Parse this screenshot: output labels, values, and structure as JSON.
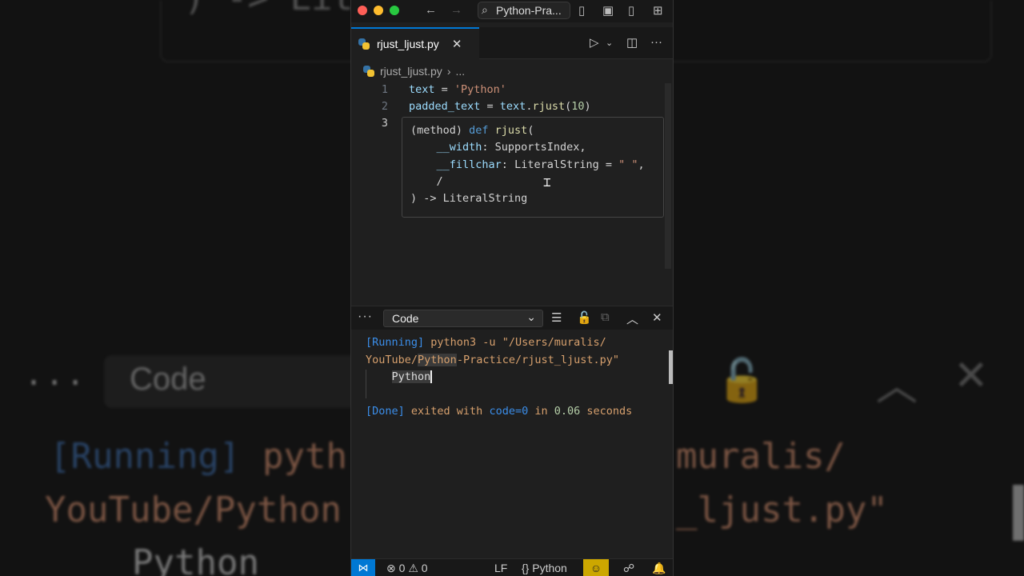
{
  "window": {
    "search_text": "Python-Pra..."
  },
  "tab": {
    "filename": "rjust_ljust.py",
    "close": "✕"
  },
  "breadcrumb": {
    "file": "rjust_ljust.py",
    "sep": "›",
    "more": "..."
  },
  "editor": {
    "lines": [
      {
        "num": "1",
        "var": "text",
        "op": " = ",
        "str": "'Python'"
      },
      {
        "num": "2",
        "var": "padded_text",
        "op": " = ",
        "obj": "text",
        "dot": ".",
        "method": "rjust",
        "open": "(",
        "arg": "10",
        "close": ")"
      },
      {
        "num": "3"
      }
    ],
    "hover": {
      "l1_a": "(method) ",
      "l1_kw": "def",
      "l1_fn": " rjust",
      "l1_b": "(",
      "l2_param": "    __width",
      "l2_b": ": ",
      "l2_type": "SupportsIndex",
      "l2_c": ",",
      "l3_param": "    __fillchar",
      "l3_b": ": ",
      "l3_type": "LiteralString",
      "l3_c": " = ",
      "l3_str": "\" \"",
      "l3_d": ",",
      "l4": "    /",
      "l5_a": ") -> ",
      "l5_type": "LiteralString"
    }
  },
  "panel": {
    "dropdown_value": "Code",
    "more": "···"
  },
  "output": {
    "running_tag": "[Running]",
    "cmd1": " python3 -u \"/Users/muralis/",
    "cmd2_a": "YouTube/",
    "cmd2_hl": "Python",
    "cmd2_b": "-Practice/rjust_ljust.py\"",
    "result_pad": "    ",
    "result": "Python",
    "done_tag": "[Done]",
    "done_a": " exited with ",
    "done_code": "code=0",
    "done_b": " in ",
    "done_time": "0.06",
    "done_c": " seconds"
  },
  "statusbar": {
    "errors": "0",
    "warnings": "0",
    "eol": "LF",
    "language": "Python"
  },
  "background": {
    "code_top": ") -> Lite",
    "dots": "···",
    "select": "Code",
    "running": "[Running]",
    "pyth": "pyth",
    "muralis": "muralis/",
    "youtube": "YouTube/Python",
    "ljust": "_ljust.py\"",
    "python": "Python"
  }
}
